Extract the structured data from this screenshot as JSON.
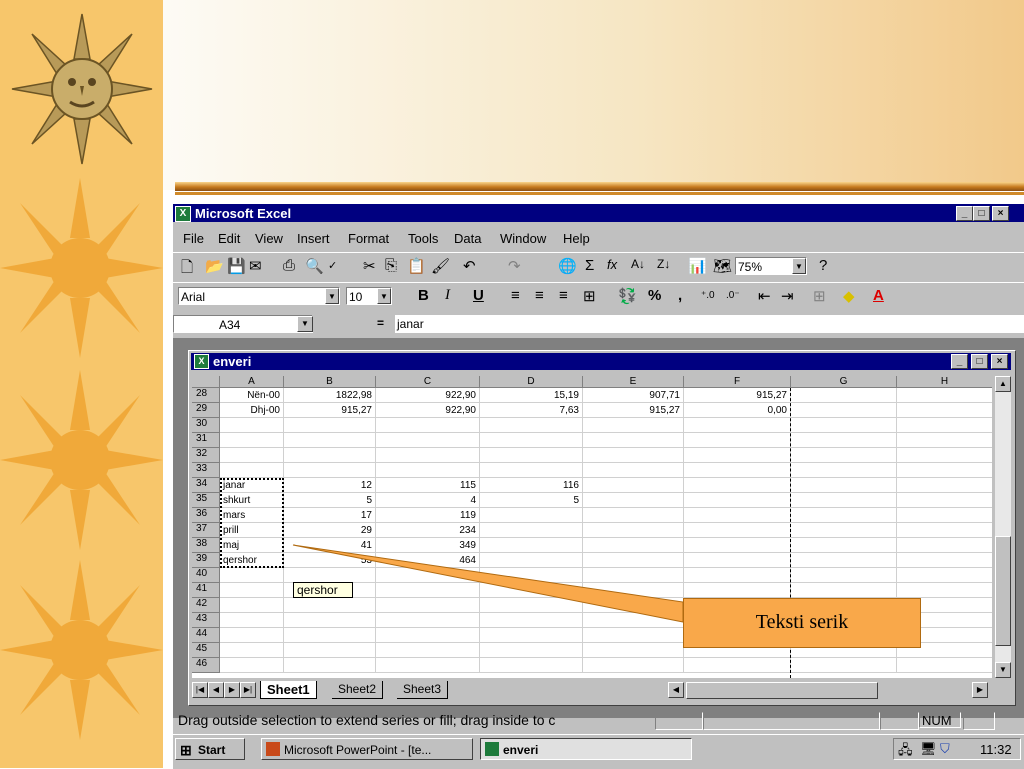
{
  "app": {
    "title": "Microsoft Excel",
    "window_controls": [
      "_",
      "□",
      "×"
    ]
  },
  "menu": [
    "File",
    "Edit",
    "View",
    "Insert",
    "Format",
    "Tools",
    "Data",
    "Window",
    "Help"
  ],
  "toolbar": {
    "zoom": "75%",
    "icons": [
      "new-icon",
      "open-icon",
      "save-icon",
      "email-icon",
      "print-icon",
      "print-preview-icon",
      "spelling-icon",
      "cut-icon",
      "copy-icon",
      "paste-icon",
      "format-painter-icon",
      "undo-icon",
      "redo-icon",
      "web-icon",
      "autosum-icon",
      "function-icon",
      "sort-ascending-icon",
      "sort-descending-icon",
      "chart-wizard-icon",
      "map-icon",
      "help-icon"
    ],
    "sum_glyph": "Σ",
    "fx_glyph": "fx"
  },
  "formatting": {
    "font": "Arial",
    "size": "10",
    "bold": "B",
    "italic": "I",
    "underline": "U",
    "percent": "%",
    "comma": ","
  },
  "formula_bar": {
    "name_box": "A34",
    "equals": "=",
    "content": "janar"
  },
  "workbook": {
    "title": "enveri",
    "columns": [
      "A",
      "B",
      "C",
      "D",
      "E",
      "F",
      "G",
      "H"
    ],
    "rows": [
      {
        "n": "28",
        "cells": [
          "Nën-00",
          "1822,98",
          "922,90",
          "15,19",
          "907,71",
          "915,27",
          "",
          ""
        ]
      },
      {
        "n": "29",
        "cells": [
          "Dhj-00",
          "915,27",
          "922,90",
          "7,63",
          "915,27",
          "0,00",
          "",
          ""
        ]
      },
      {
        "n": "30",
        "cells": [
          "",
          "",
          "",
          "",
          "",
          "",
          "",
          ""
        ]
      },
      {
        "n": "31",
        "cells": [
          "",
          "",
          "",
          "",
          "",
          "",
          "",
          ""
        ]
      },
      {
        "n": "32",
        "cells": [
          "",
          "",
          "",
          "",
          "",
          "",
          "",
          ""
        ]
      },
      {
        "n": "33",
        "cells": [
          "",
          "",
          "",
          "",
          "",
          "",
          "",
          ""
        ]
      },
      {
        "n": "34",
        "cells": [
          "janar",
          "12",
          "115",
          "116",
          "",
          "",
          "",
          ""
        ]
      },
      {
        "n": "35",
        "cells": [
          "shkurt",
          "5",
          "4",
          "5",
          "",
          "",
          "",
          ""
        ]
      },
      {
        "n": "36",
        "cells": [
          "mars",
          "17",
          "119",
          "",
          "",
          "",
          "",
          ""
        ]
      },
      {
        "n": "37",
        "cells": [
          "prill",
          "29",
          "234",
          "",
          "",
          "",
          "",
          ""
        ]
      },
      {
        "n": "38",
        "cells": [
          "maj",
          "41",
          "349",
          "",
          "",
          "",
          "",
          ""
        ]
      },
      {
        "n": "39",
        "cells": [
          "qershor",
          "53",
          "464",
          "",
          "",
          "",
          "",
          ""
        ]
      },
      {
        "n": "40",
        "cells": [
          "",
          "",
          "",
          "",
          "",
          "",
          "",
          ""
        ]
      },
      {
        "n": "41",
        "cells": [
          "",
          "",
          "",
          "",
          "",
          "",
          "",
          ""
        ]
      },
      {
        "n": "42",
        "cells": [
          "",
          "",
          "",
          "",
          "",
          "",
          "",
          ""
        ]
      },
      {
        "n": "43",
        "cells": [
          "",
          "",
          "",
          "",
          "",
          "",
          "",
          ""
        ]
      },
      {
        "n": "44",
        "cells": [
          "",
          "",
          "",
          "",
          "",
          "",
          "",
          ""
        ]
      },
      {
        "n": "45",
        "cells": [
          "",
          "",
          "",
          "",
          "",
          "",
          "",
          ""
        ]
      },
      {
        "n": "46",
        "cells": [
          "",
          "",
          "",
          "",
          "",
          "",
          "",
          ""
        ]
      }
    ],
    "tabs": [
      "Sheet1",
      "Sheet2",
      "Sheet3"
    ],
    "active_tab": "Sheet1",
    "fill_tooltip": "qershor"
  },
  "status": {
    "message": "Drag outside selection to extend series or fill; drag inside to c",
    "num": "NUM"
  },
  "taskbar": {
    "start": "Start",
    "items": [
      "Microsoft PowerPoint - [te...",
      "enveri"
    ],
    "clock": "11:32"
  },
  "callout": "Teksti serik",
  "colors": {
    "sidebar": "#f7c66b",
    "title_bar": "#000080",
    "callout": "#f9a84a"
  }
}
